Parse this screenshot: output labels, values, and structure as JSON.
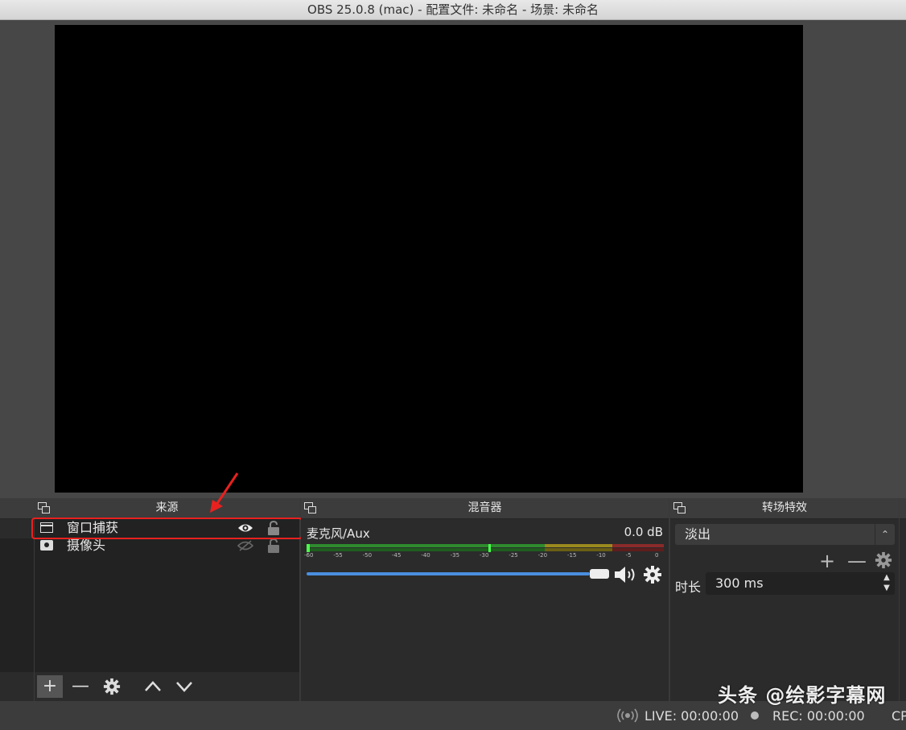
{
  "window": {
    "title": "OBS 25.0.8 (mac) - 配置文件: 未命名 - 场景: 未命名"
  },
  "docks": {
    "sources_title": "来源",
    "mixer_title": "混音器",
    "transitions_title": "转场特效"
  },
  "sources": {
    "items": [
      {
        "label": "窗口捕获",
        "icon": "window-icon",
        "visible": true,
        "locked": false
      },
      {
        "label": "摄像头",
        "icon": "camera-icon",
        "visible": false,
        "locked": false
      }
    ]
  },
  "mixer": {
    "channel_name": "麦克风/Aux",
    "db": "0.0 dB",
    "ticks": [
      "-60",
      "-55",
      "-50",
      "-45",
      "-40",
      "-35",
      "-30",
      "-25",
      "-20",
      "-15",
      "-10",
      "-5",
      "0"
    ],
    "volume": 1.0
  },
  "transitions": {
    "selected": "淡出",
    "duration_label": "时长",
    "duration_value": "300 ms"
  },
  "status": {
    "live": "LIVE: 00:00:00",
    "rec": "REC: 00:00:00",
    "cpu": "CP"
  },
  "watermark": "头条 @绘影字幕网",
  "colors": {
    "highlight": "#e8211f",
    "slider": "#4a8fe0",
    "meter_green": "#2e8b2e",
    "meter_yellow": "#9a8a1e",
    "meter_red": "#8b2a2a"
  }
}
